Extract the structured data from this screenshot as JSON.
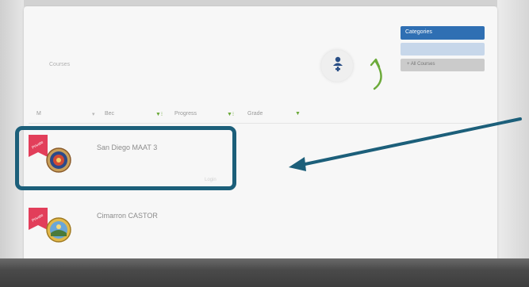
{
  "header": {
    "course_header": "",
    "course_sub": "Courses",
    "add_label": ""
  },
  "sidebar_buttons": {
    "categories_label": "Categories",
    "all_courses_label": "+ All Courses"
  },
  "filters": {
    "col1": "M",
    "col2": "Bec",
    "col3": "Progress",
    "col4": "Grade",
    "col5": ""
  },
  "courses": [
    {
      "badge": "Private",
      "title": "San Diego MAAT 3",
      "meta": "",
      "meta2": "",
      "link": "Login"
    },
    {
      "badge": "Private",
      "title": "Cimarron CASTOR",
      "meta": "",
      "meta2": "",
      "link": ""
    }
  ],
  "colors": {
    "accent": "#2f6fb3",
    "highlight": "#1c5f7a",
    "green_arrow": "#6caa3a",
    "badge_red": "#e23e5a"
  },
  "icons": {
    "add": "add-course-icon",
    "seal": "county-seal-icon"
  }
}
